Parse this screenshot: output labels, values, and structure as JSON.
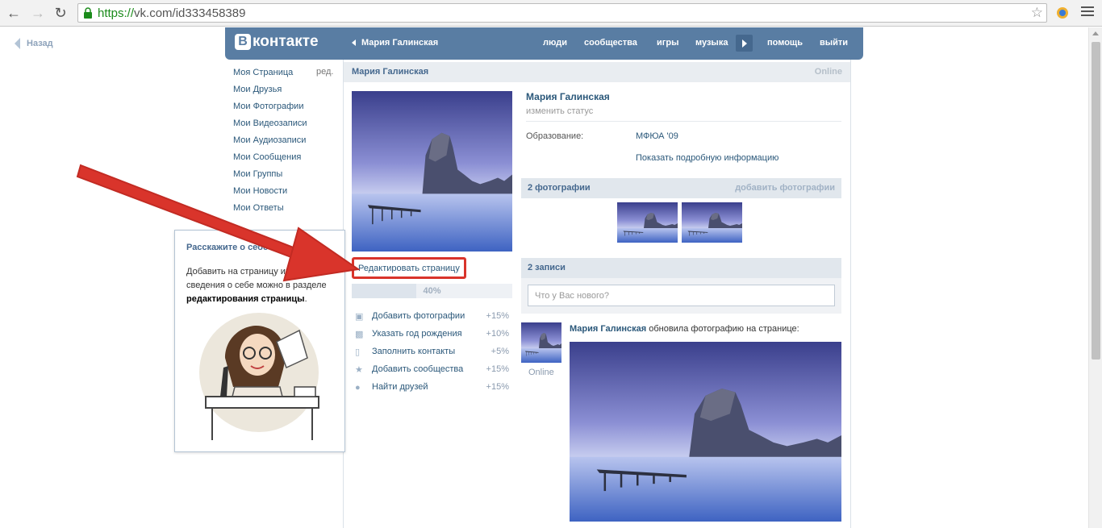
{
  "browser": {
    "url_scheme": "https://",
    "url_rest": "vk.com/id333458389",
    "back_icon": "arrow-left-icon",
    "forward_icon": "arrow-right-icon",
    "reload_icon": "reload-icon"
  },
  "page_back": "Назад",
  "header": {
    "logo_letter": "В",
    "logo_text": "контакте",
    "back_name": "Мария Галинская",
    "menu": [
      "люди",
      "сообщества",
      "игры",
      "музыка",
      "помощь",
      "выйти"
    ]
  },
  "sidebar": {
    "items": [
      "Моя Страница",
      "Мои Друзья",
      "Мои Фотографии",
      "Мои Видеозаписи",
      "Мои Аудиозаписи",
      "Мои Сообщения",
      "Мои Группы",
      "Мои Новости",
      "Мои Ответы"
    ],
    "edit": "ред."
  },
  "profile": {
    "bar_name": "Мария Галинская",
    "bar_status": "Online",
    "name": "Мария Галинская",
    "status": "изменить статус",
    "edu_label": "Образование:",
    "edu_value": "МФЮА '09",
    "more_info": "Показать подробную информацию",
    "edit_page": "Редактировать страницу",
    "progress": {
      "label": "40%",
      "value": 0.4
    }
  },
  "tasks": [
    {
      "icon": "camera-icon",
      "label": "Добавить фотографии",
      "pct": "+15%"
    },
    {
      "icon": "gift-icon",
      "label": "Указать год рождения",
      "pct": "+10%"
    },
    {
      "icon": "phone-icon",
      "label": "Заполнить контакты",
      "pct": "+5%"
    },
    {
      "icon": "star-icon",
      "label": "Добавить сообщества",
      "pct": "+15%"
    },
    {
      "icon": "friends-icon",
      "label": "Найти друзей",
      "pct": "+15%"
    }
  ],
  "photos_section": {
    "title": "2 фотографии",
    "action": "добавить фотографии"
  },
  "wall_section": {
    "title": "2 записи",
    "placeholder": "Что у Вас нового?"
  },
  "post": {
    "author": "Мария Галинская",
    "action": "обновила фотографию на странице:",
    "online": "Online"
  },
  "tooltip": {
    "title": "Расскажите о себе",
    "text": "Добавить на страницу интересные сведения о себе можно в разделе ",
    "text_bold": "редактирования страницы",
    "text_end": "."
  },
  "colors": {
    "vk_blue": "#597da3",
    "link": "#2b587a",
    "annotation_red": "#d9342b"
  }
}
